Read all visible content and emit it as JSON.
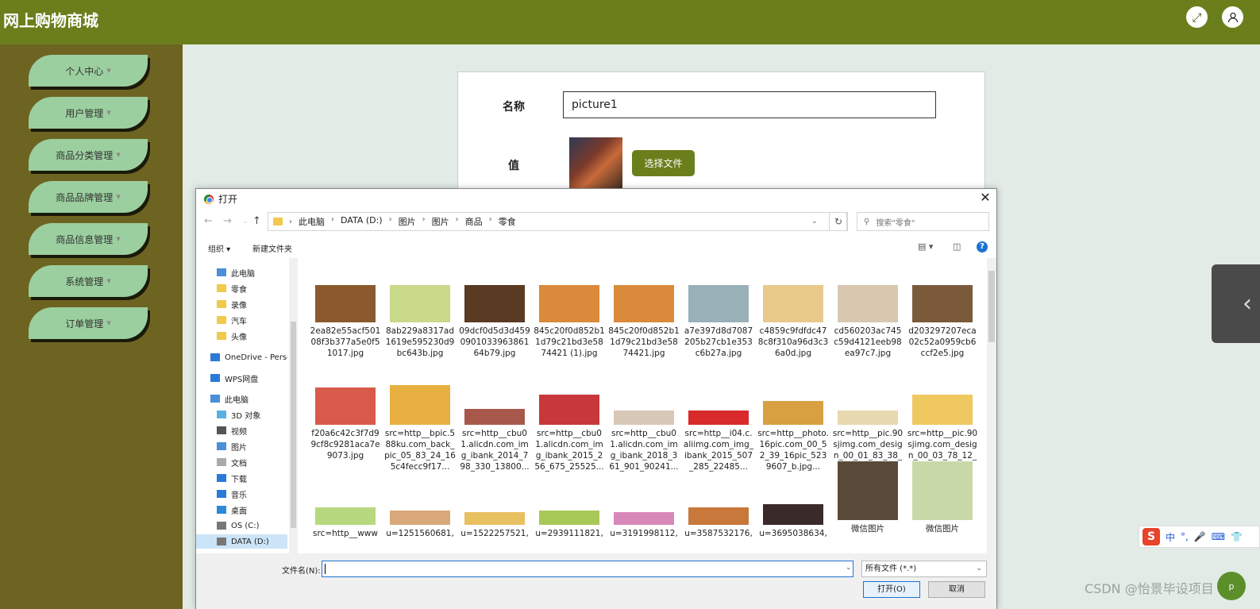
{
  "app": {
    "title": "网上购物商城"
  },
  "sidebar": {
    "items": [
      {
        "label": "个人中心"
      },
      {
        "label": "用户管理"
      },
      {
        "label": "商品分类管理"
      },
      {
        "label": "商品品牌管理"
      },
      {
        "label": "商品信息管理"
      },
      {
        "label": "系统管理"
      },
      {
        "label": "订单管理"
      }
    ]
  },
  "form": {
    "name_label": "名称",
    "name_value": "picture1",
    "value_label": "值",
    "choose_file_label": "选择文件"
  },
  "dialog": {
    "title": "打开",
    "breadcrumb": [
      "此电脑",
      "DATA (D:)",
      "图片",
      "图片",
      "商品",
      "零食"
    ],
    "search_placeholder": "搜索\"零食\"",
    "toolbar": {
      "organize": "组织",
      "new_folder": "新建文件夹"
    },
    "nav_items": [
      {
        "label": "此电脑",
        "icon": "computer-icon"
      },
      {
        "label": "零食",
        "icon": "folder-icon"
      },
      {
        "label": "录像",
        "icon": "folder-icon"
      },
      {
        "label": "汽车",
        "icon": "folder-icon"
      },
      {
        "label": "头像",
        "icon": "folder-icon"
      },
      {
        "label": "OneDrive - Perso",
        "icon": "cloud-icon"
      },
      {
        "label": "WPS网盘",
        "icon": "cloud-icon"
      },
      {
        "label": "此电脑",
        "icon": "computer-icon"
      },
      {
        "label": "3D 对象",
        "icon": "cube-icon"
      },
      {
        "label": "视频",
        "icon": "video-icon"
      },
      {
        "label": "图片",
        "icon": "picture-icon"
      },
      {
        "label": "文档",
        "icon": "document-icon"
      },
      {
        "label": "下载",
        "icon": "download-icon"
      },
      {
        "label": "音乐",
        "icon": "music-icon"
      },
      {
        "label": "桌面",
        "icon": "desktop-icon"
      },
      {
        "label": "OS (C:)",
        "icon": "drive-icon"
      },
      {
        "label": "DATA (D:)",
        "icon": "drive-icon"
      }
    ],
    "files": [
      {
        "name": "2ea82e55acf50108f3b377a5e0f51017.jpg",
        "color": "#8a5a2e"
      },
      {
        "name": "8ab229a8317ad1619e595230d9bc643b.jpg",
        "color": "#c9d98a"
      },
      {
        "name": "09dcf0d5d3d459090103396386164b79.jpg",
        "color": "#5a3a22"
      },
      {
        "name": "845c20f0d852b11d79c21bd3e5874421 (1).jpg",
        "color": "#d98a3a"
      },
      {
        "name": "845c20f0d852b11d79c21bd3e5874421.jpg",
        "color": "#d98a3a"
      },
      {
        "name": "a7e397d8d7087205b27cb1e353c6b27a.jpg",
        "color": "#9ab0b8"
      },
      {
        "name": "c4859c9fdfdc478c8f310a96d3c36a0d.jpg",
        "color": "#e8c98a"
      },
      {
        "name": "cd560203ac745c59d4121eeb98ea97c7.jpg",
        "color": "#d8c8b0"
      },
      {
        "name": "d203297207eca02c52a0959cb6ccf2e5.jpg",
        "color": "#7a5a3a"
      },
      {
        "name": "f20a6c42c3f7d99cf8c9281aca7e9073.jpg",
        "color": "#d85a4a"
      },
      {
        "name": "src=http__bpic.588ku.com_back_pic_05_83_24_165c4fecc9f17...",
        "color": "#e8b040"
      },
      {
        "name": "src=http__cbu01.alicdn.com_img_ibank_2014_798_330_13800...",
        "color": "#a8584a"
      },
      {
        "name": "src=http__cbu01.alicdn.com_img_ibank_2015_256_675_25525...",
        "color": "#c8383a"
      },
      {
        "name": "src=http__cbu01.alicdn.com_img_ibank_2018_361_901_90241...",
        "color": "#d8c8b8"
      },
      {
        "name": "src=http__i04.c.aliimg.com_img_ibank_2015_507_285_22485...",
        "color": "#d82a2a"
      },
      {
        "name": "src=http__photo.16pic.com_00_52_39_16pic_5239607_b.jpg...",
        "color": "#d8a040"
      },
      {
        "name": "src=http__pic.90sjimg.com_design_00_01_83_38_557695c6ec...",
        "color": "#e8d8b0"
      },
      {
        "name": "src=http__pic.90sjimg.com_design_00_03_78_12_55067fe545f...",
        "color": "#f0c860"
      },
      {
        "name": "src=http__www",
        "color": "#b8d880"
      },
      {
        "name": "u=1251560681,",
        "color": "#d8a878"
      },
      {
        "name": "u=1522257521,",
        "color": "#e8c060"
      },
      {
        "name": "u=2939111821,",
        "color": "#a8c858"
      },
      {
        "name": "u=3191998112,",
        "color": "#d888b8"
      },
      {
        "name": "u=3587532176,",
        "color": "#c8783a"
      },
      {
        "name": "u=3695038634,",
        "color": "#3a2a2a"
      },
      {
        "name": "微信图片",
        "color": "#5a4a3a"
      },
      {
        "name": "微信图片",
        "color": "#c8d8a8"
      }
    ],
    "filename_label": "文件名(N):",
    "filename_value": "",
    "filetype_value": "所有文件 (*.*)",
    "open_label": "打开(O)",
    "cancel_label": "取消"
  },
  "ime": {
    "mode": "中"
  },
  "watermark": {
    "text": "CSDN @怡景毕设项目"
  },
  "chat": {
    "label": "p"
  },
  "colors": {
    "topbar": "#6a7f1c",
    "sidebar": "#6e6422",
    "menu_item": "#9bcf9f",
    "accent": "#6a7f1c"
  }
}
